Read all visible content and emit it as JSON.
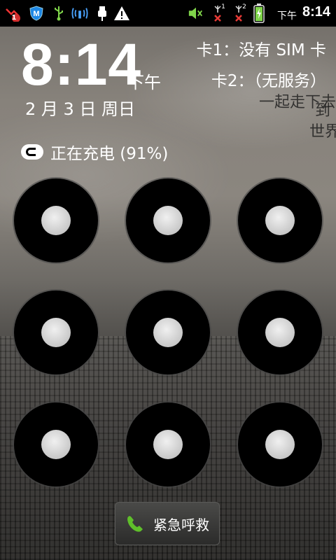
{
  "status_bar": {
    "icons": [
      "missed-call-icon",
      "security-m-icon",
      "usb-icon",
      "wifi-icon",
      "usb-plug-icon",
      "warning-icon",
      "volume-muted-icon",
      "sim1-no-signal-icon",
      "sim2-no-signal-icon",
      "battery-charging-icon"
    ],
    "missed_count": "1",
    "sim1_mark": "1",
    "sim2_mark": "2",
    "ampm": "下午",
    "time": "8:14"
  },
  "lock": {
    "time": "8:14",
    "ampm": "下午",
    "date": "2 月 3 日 周日",
    "sim1": "卡1：没有 SIM 卡",
    "sim2": "卡2：（无服务）",
    "charging": "正在充电 (91%)"
  },
  "wallpaper": {
    "lines": [
      "一起走下去",
      "到",
      "世界"
    ]
  },
  "pattern": {
    "dots": 9
  },
  "emergency": {
    "label": "紧急呼救"
  },
  "colors": {
    "status_bg": "#000000",
    "accent_green": "#5fbf2a",
    "warning_red": "#d32f2f"
  }
}
